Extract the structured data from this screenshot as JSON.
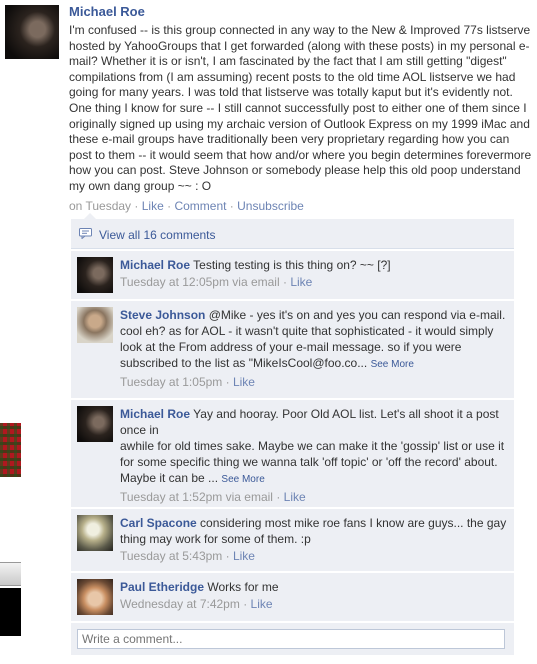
{
  "post": {
    "author": "Michael Roe",
    "text": "I'm confused -- is this group connected in any way to the New & Improved 77s listserve hosted by YahooGroups that I get forwarded (along with these posts) in my personal e-mail? Whether it is or isn't, I am fascinated by the fact that I am still getting \"digest\" compilations from (I am assuming) recent posts to the old time AOL listserve we had going for many years. I was told that listserve was totally kaput but it's evidently not. One thing I know for sure -- I still cannot successfully post to either one of them since I originally signed up using my archaic version of Outlook Express on my 1999 iMac and these e-mail groups have traditionally been very proprietary regarding how you can post to them -- it would seem that how and/or where you begin determines forevermore how you can post. Steve Johnson or somebody please help this old poop understand my own dang group ~~ : O",
    "time": "on Tuesday",
    "like": "Like",
    "comment": "Comment",
    "unsubscribe": "Unsubscribe",
    "sep": "·"
  },
  "view_all": "View all 16 comments",
  "comments": [
    {
      "author": "Michael Roe",
      "text": "Testing testing is this thing on? ~~ [?]",
      "time": "Tuesday at 12:05pm via email",
      "like": "Like"
    },
    {
      "author": "Steve Johnson",
      "text": "@Mike - yes it's on and yes you can respond via e-mail. cool eh? as for AOL - it wasn't quite that sophisticated - it would simply look at the From address of your e-mail message. so if you were subscribed to the list as \"MikeIsCool@foo.co...",
      "see_more": "See More",
      "time": "Tuesday at 1:05pm",
      "like": "Like"
    },
    {
      "author": "Michael Roe",
      "text_line1": "Yay and hooray. Poor Old AOL list. Let's all shoot it a post once in",
      "text_rest": "awhile for old times sake. Maybe we can make it the 'gossip' list or use it for some specific thing we wanna talk 'off topic' or 'off the record' about. Maybe it can be ...",
      "see_more": "See More",
      "time": "Tuesday at 1:52pm via email",
      "like": "Like"
    },
    {
      "author": "Carl Spacone",
      "text": "considering most mike roe fans I know are guys... the gay thing may work for some of them. :p",
      "time": "Tuesday at 5:43pm",
      "like": "Like"
    },
    {
      "author": "Paul Etheridge",
      "text": "Works for me",
      "time": "Wednesday at 7:42pm",
      "like": "Like"
    }
  ],
  "write_comment_placeholder": "Write a comment...",
  "sep": "·"
}
